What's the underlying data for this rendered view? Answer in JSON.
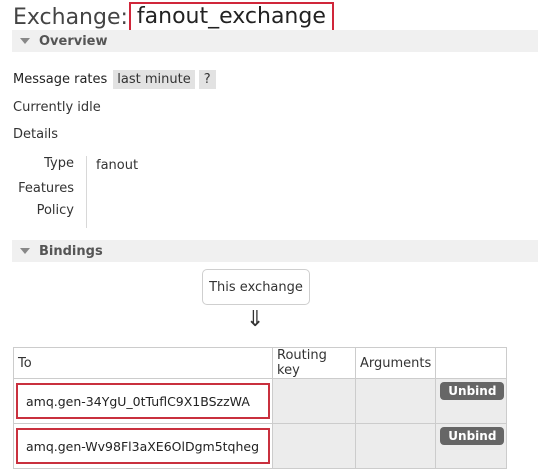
{
  "page": {
    "title_prefix": "Exchange:",
    "exchange_name": "fanout_exchange"
  },
  "overview": {
    "heading": "Overview",
    "message_rates_label": "Message rates",
    "rate_window": "last minute",
    "help_label": "?",
    "status": "Currently idle",
    "details_label": "Details",
    "details": {
      "type_key": "Type",
      "type_value": "fanout",
      "features_key": "Features",
      "policy_key": "Policy"
    }
  },
  "bindings": {
    "heading": "Bindings",
    "this_exchange": "This exchange",
    "arrow": "⇓",
    "columns": {
      "to": "To",
      "routing_key": "Routing key",
      "arguments": "Arguments"
    },
    "rows": [
      {
        "to": "amq.gen-34YgU_0tTuflC9X1BSzzWA",
        "routing_key": "",
        "arguments": "",
        "action": "Unbind"
      },
      {
        "to": "amq.gen-Wv98Fl3aXE6OlDgm5tqheg",
        "routing_key": "",
        "arguments": "",
        "action": "Unbind"
      }
    ]
  },
  "colors": {
    "highlight": "#d0263a",
    "button": "#666666",
    "section_bg": "#f0f0f0"
  }
}
